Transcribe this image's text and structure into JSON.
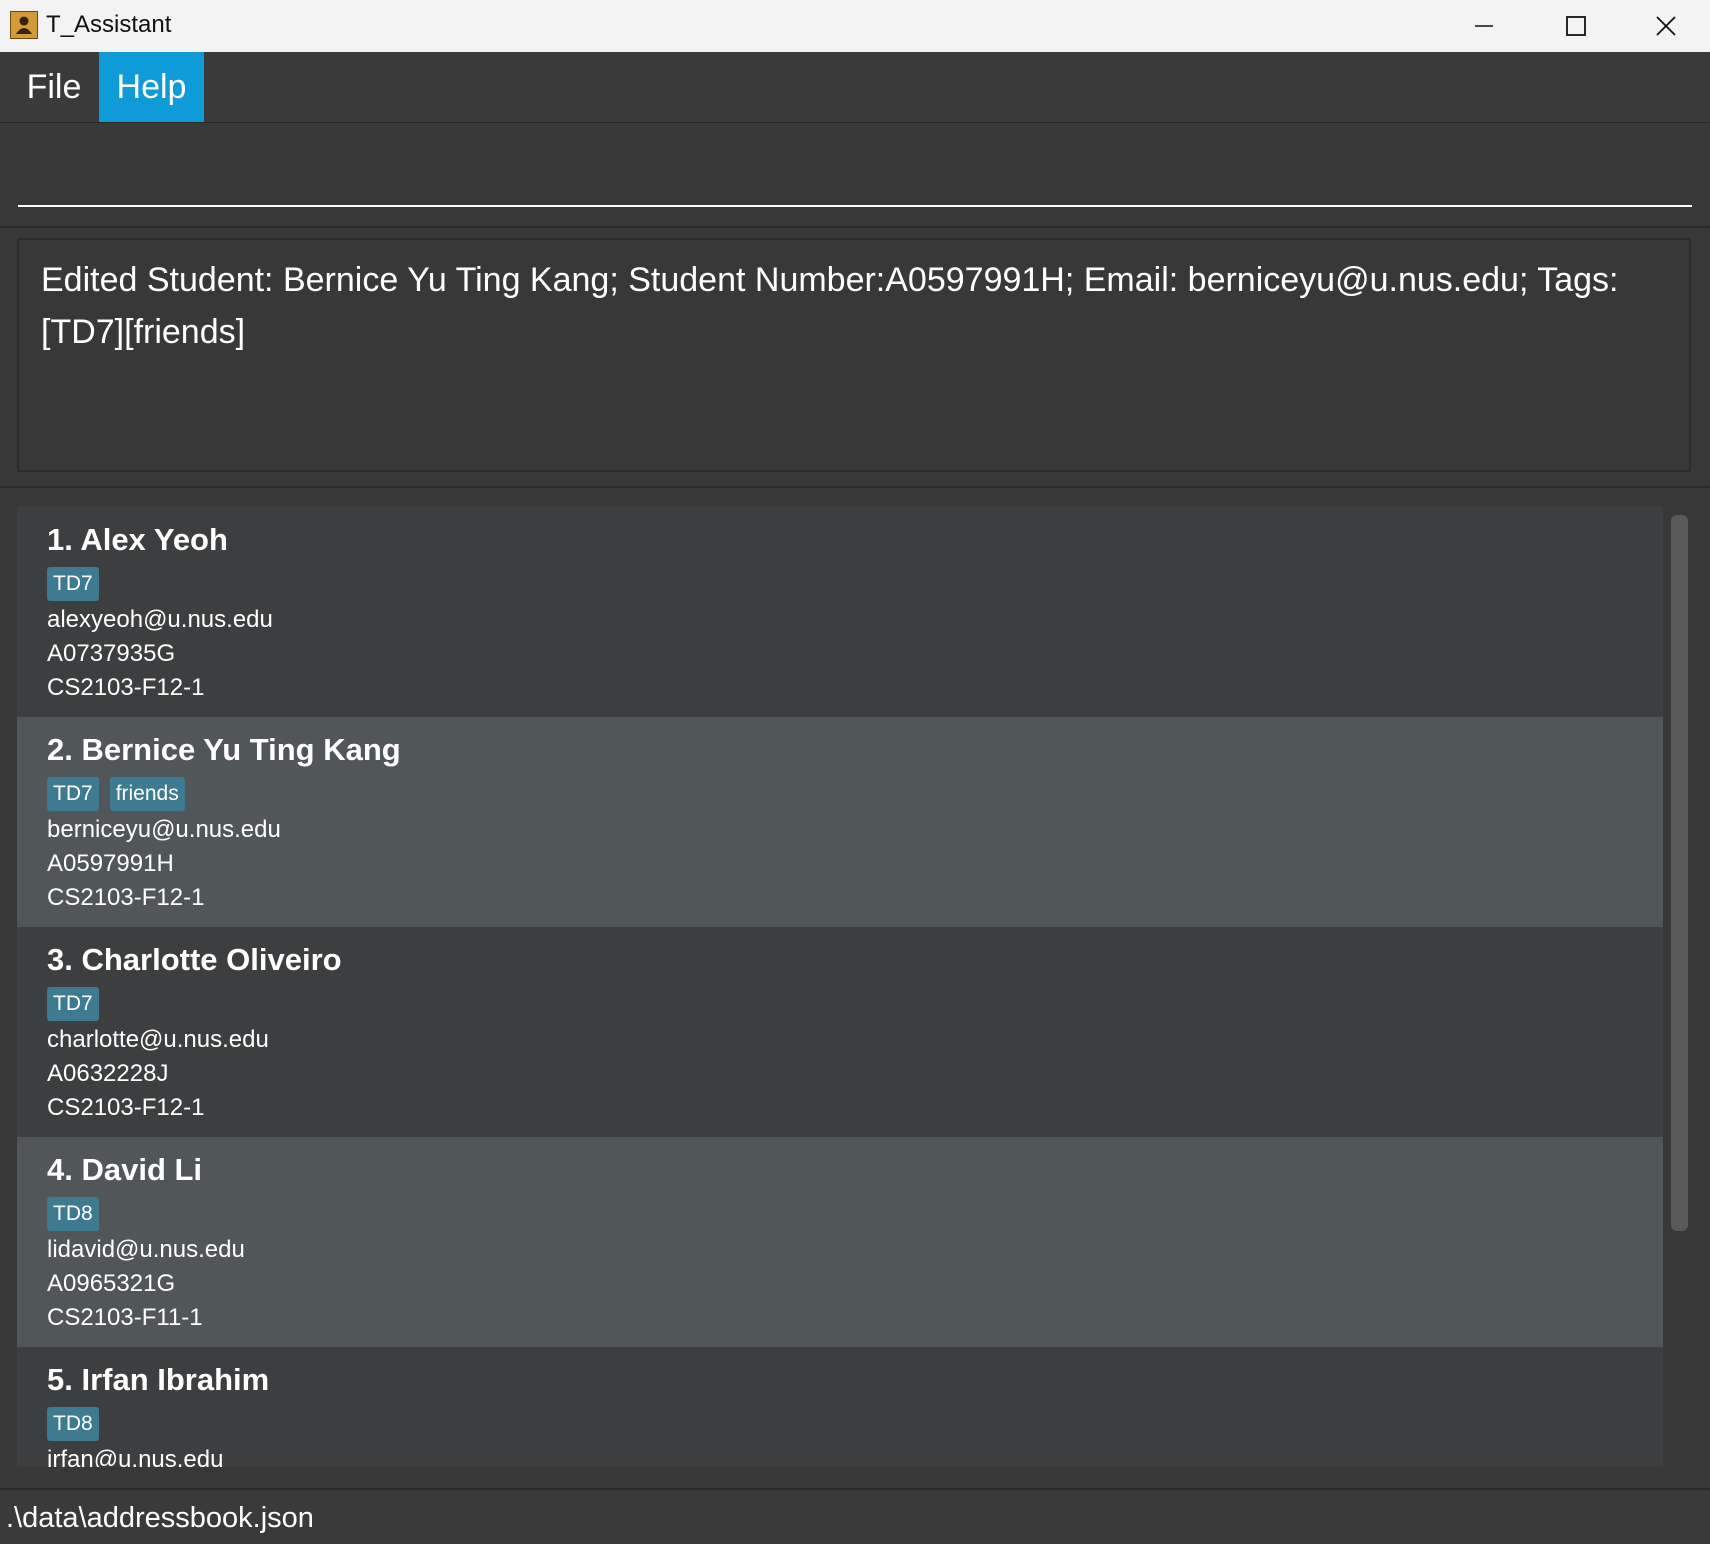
{
  "window": {
    "title": "T_Assistant",
    "icon": "address-book-icon"
  },
  "menu": {
    "items": [
      {
        "label": "File",
        "active": false
      },
      {
        "label": "Help",
        "active": true
      }
    ],
    "active_color": "#0f9bd7"
  },
  "command": {
    "value": "",
    "placeholder": ""
  },
  "result": {
    "text": "Edited Student: Bernice Yu Ting Kang; Student Number:A0597991H; Email: berniceyu@u.nus.edu; Tags: [TD7][friends]"
  },
  "students": [
    {
      "title": "1. Alex Yeoh",
      "tags": [
        "TD7"
      ],
      "email": "alexyeoh@u.nus.edu",
      "student_number": "A0737935G",
      "class": "CS2103-F12-1"
    },
    {
      "title": "2. Bernice Yu Ting Kang",
      "tags": [
        "TD7",
        "friends"
      ],
      "email": "berniceyu@u.nus.edu",
      "student_number": "A0597991H",
      "class": "CS2103-F12-1"
    },
    {
      "title": "3. Charlotte Oliveiro",
      "tags": [
        "TD7"
      ],
      "email": "charlotte@u.nus.edu",
      "student_number": "A0632228J",
      "class": "CS2103-F12-1"
    },
    {
      "title": "4. David Li",
      "tags": [
        "TD8"
      ],
      "email": "lidavid@u.nus.edu",
      "student_number": "A0965321G",
      "class": "CS2103-F11-1"
    },
    {
      "title": "5. Irfan Ibrahim",
      "tags": [
        "TD8"
      ],
      "email": "irfan@u.nus.edu",
      "student_number": "",
      "class": ""
    }
  ],
  "status": {
    "file_path": ".\\data\\addressbook.json"
  },
  "colors": {
    "background": "#383838",
    "card_odd": "#3c3e3f",
    "card_even": "#515658",
    "tag": "#3e7b91"
  }
}
